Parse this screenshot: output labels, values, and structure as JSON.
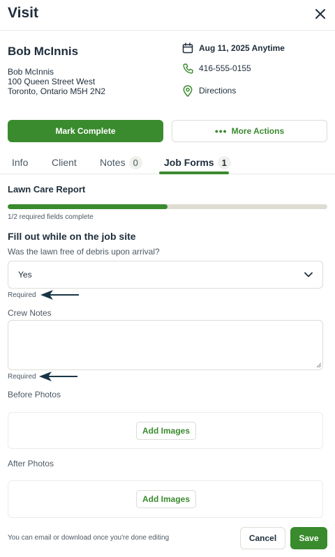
{
  "header": {
    "title": "Visit"
  },
  "client": {
    "name": "Bob McInnis",
    "address_lines": [
      "Bob McInnis",
      "100 Queen Street West",
      "Toronto, Ontario M5H 2N2"
    ]
  },
  "details": {
    "date": "Aug 11, 2025 Anytime",
    "phone": "416-555-0155",
    "directions": "Directions"
  },
  "actions": {
    "primary": "Mark Complete",
    "more": "More Actions"
  },
  "tabs": [
    {
      "label": "Info"
    },
    {
      "label": "Client"
    },
    {
      "label": "Notes",
      "count": "0"
    },
    {
      "label": "Job Forms",
      "count": "1",
      "active": true
    }
  ],
  "form": {
    "title": "Lawn Care Report",
    "progress_fraction": 0.5,
    "progress_text": "1/2 required fields complete",
    "section_title": "Fill out while on the job site",
    "question": "Was the lawn free of debris upon arrival?",
    "answer": "Yes",
    "required_label": "Required",
    "crew_notes_label": "Crew Notes",
    "crew_notes_value": "",
    "before_photos_label": "Before Photos",
    "after_photos_label": "After Photos",
    "add_images_label": "Add Images"
  },
  "footer": {
    "note": "You can email or download once you're done editing",
    "cancel": "Cancel",
    "save": "Save"
  },
  "colors": {
    "accent": "#3a8a2e",
    "text": "#1e2d3b",
    "arrow": "#183546"
  }
}
